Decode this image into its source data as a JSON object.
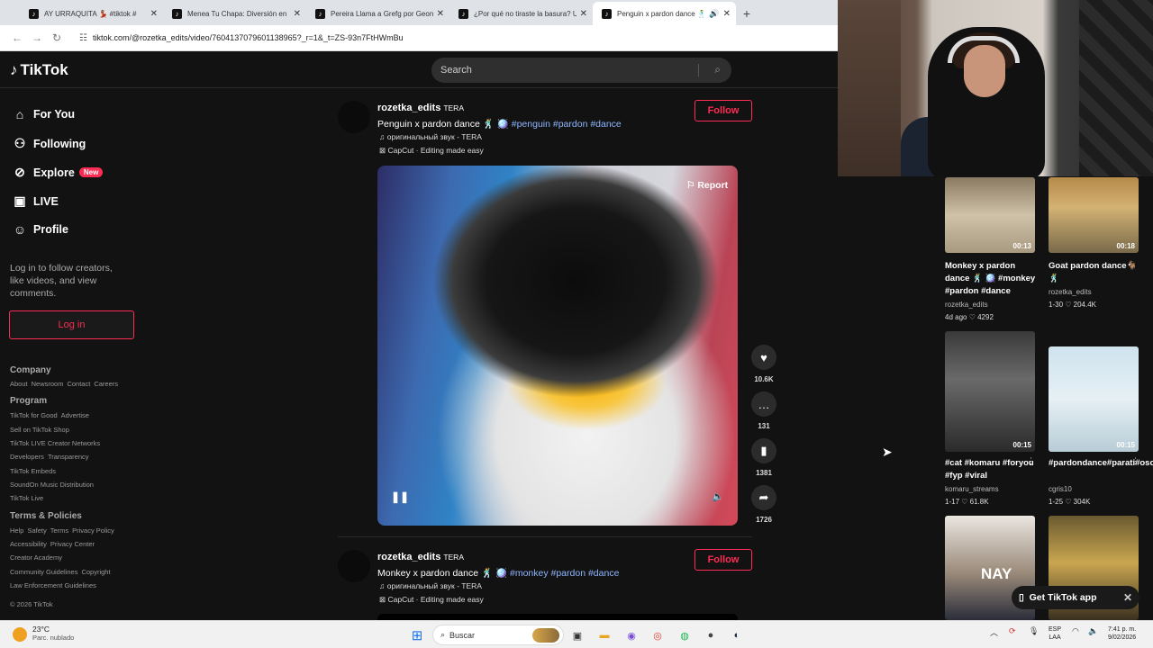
{
  "browser": {
    "tabs": [
      {
        "label": "AY URRAQUITA 💃🏽 #tiktok #",
        "active": false
      },
      {
        "label": "Menea Tu Chapa: Diversión en",
        "active": false
      },
      {
        "label": "Pereira Llama a Grefg por Geon",
        "active": false
      },
      {
        "label": "¿Por qué no tiraste la basura? U",
        "active": false
      },
      {
        "label": "Penguin x pardon dance 🕺",
        "active": true
      }
    ],
    "url": "tiktok.com/@rozetka_edits/video/7604137079601138965?_r=1&_t=ZS-93n7FtHWmBu"
  },
  "header": {
    "logo": "TikTok",
    "search_placeholder": "Search"
  },
  "sidebar": {
    "nav": [
      {
        "label": "For You",
        "icon": "home-icon"
      },
      {
        "label": "Following",
        "icon": "following-icon"
      },
      {
        "label": "Explore",
        "icon": "compass-icon",
        "badge": "New"
      },
      {
        "label": "LIVE",
        "icon": "live-icon"
      },
      {
        "label": "Profile",
        "icon": "profile-icon"
      }
    ],
    "login_hint": "Log in to follow creators, like videos, and view comments.",
    "login_button": "Log in",
    "footer": {
      "company_title": "Company",
      "company_links": [
        "About",
        "Newsroom",
        "Contact",
        "Careers"
      ],
      "program_title": "Program",
      "program_links": [
        [
          "TikTok for Good",
          "Advertise"
        ],
        [
          "Sell on TikTok Shop"
        ],
        [
          "TikTok LIVE Creator Networks"
        ],
        [
          "Developers",
          "Transparency"
        ],
        [
          "TikTok Embeds"
        ],
        [
          "SoundOn Music Distribution"
        ],
        [
          "TikTok Live"
        ]
      ],
      "terms_title": "Terms & Policies",
      "terms_links": [
        [
          "Help",
          "Safety",
          "Terms",
          "Privacy Policy"
        ],
        [
          "Accessibility",
          "Privacy Center"
        ],
        [
          "Creator Academy"
        ],
        [
          "Community Guidelines",
          "Copyright"
        ],
        [
          "Law Enforcement Guidelines"
        ]
      ],
      "copyright": "© 2026 TikTok"
    }
  },
  "feed": {
    "posts": [
      {
        "username": "rozetka_edits",
        "nickname": "TERA",
        "caption": "Penguin x pardon dance 🕺 🪩",
        "tags": "#penguin #pardon #dance",
        "music": "♫ оригинальный звук - TERA",
        "capcut": "CapCut · Editing made easy",
        "follow": "Follow",
        "report": "Report",
        "likes": "10.6K",
        "comments": "131",
        "saves": "1381",
        "shares": "1726"
      },
      {
        "username": "rozetka_edits",
        "nickname": "TERA",
        "caption": "Monkey x pardon dance 🕺 🪩",
        "tags": "#monkey #pardon #dance",
        "music": "♫ оригинальный звук - TERA",
        "capcut": "CapCut · Editing made easy",
        "follow": "Follow"
      }
    ]
  },
  "related": [
    {
      "duration": "00:13",
      "title": "Monkey x pardon dance 🕺 🪩 #monkey #pardon #dance",
      "user": "rozetka_edits",
      "date": "4d ago",
      "likes": "4292"
    },
    {
      "duration": "00:18",
      "title": "Goat pardon dance🐐🕺",
      "user": "rozetka_edits",
      "date": "1-30",
      "likes": "204.4K"
    },
    {
      "duration": "00:15",
      "title": "#cat #komaru #foryou #fyp #viral",
      "user": "komaru_streams",
      "date": "1-17",
      "likes": "61.8K"
    },
    {
      "duration": "00:15",
      "title": "#pardondance#parati#osopolar",
      "user": "cgris10",
      "date": "1-25",
      "likes": "304K"
    },
    {
      "duration": "",
      "title": "",
      "user": "",
      "date": "",
      "likes": "",
      "overlay": "NAY"
    }
  ],
  "get_app": "Get TikTok app",
  "taskbar": {
    "temp": "23°C",
    "weather": "Parc. nublado",
    "search": "Buscar",
    "lang1": "ESP",
    "lang2": "LAA",
    "time": "7:41 p. m.",
    "date": "9/02/2026"
  }
}
